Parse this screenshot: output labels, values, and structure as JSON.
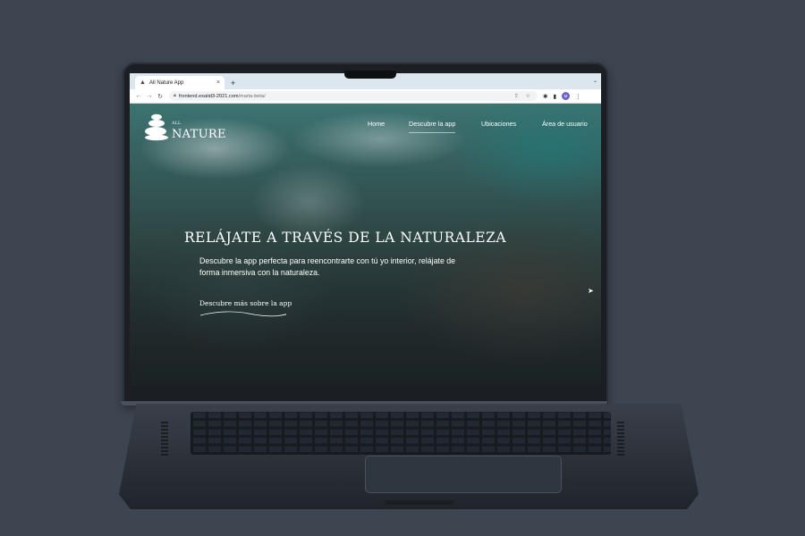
{
  "browser": {
    "tab_title": "All Nature App",
    "tab_close": "×",
    "new_tab": "+",
    "tab_menu": "⌄",
    "nav_back": "←",
    "nav_forward": "→",
    "nav_reload": "↻",
    "url_host": "frontend.exatid3-2021.com",
    "url_path": "/marta-beta/",
    "omnibox_icons": "⇪ ☆",
    "profile_initial": "M"
  },
  "site": {
    "logo_small": "ALL",
    "logo_big": "NATURE",
    "nav": {
      "home": "Home",
      "discover": "Descubre la app",
      "locations": "Ubicaciones",
      "user_area": "Área de usuario"
    },
    "hero": {
      "title": "RELÁJATE A TRAVÉS DE LA NATURALEZA",
      "text": "Descubre la app perfecta para reencontrarte con tú yo interior, relájate de forma inmersiva con la naturaleza.",
      "link": "Descubre más sobre la app"
    }
  },
  "colors": {
    "background": "#3c4550",
    "laptop": "#2a2f37",
    "tabbar": "#dbe6ee",
    "hero_text": "#ffffff"
  },
  "icons": [
    "favicon-icon",
    "close-icon",
    "plus-icon",
    "back-icon",
    "forward-icon",
    "reload-icon",
    "lock-icon",
    "share-icon",
    "star-icon",
    "extensions-icon",
    "sidebar-icon",
    "menu-icon",
    "logo-stones-icon",
    "cursor-icon"
  ]
}
